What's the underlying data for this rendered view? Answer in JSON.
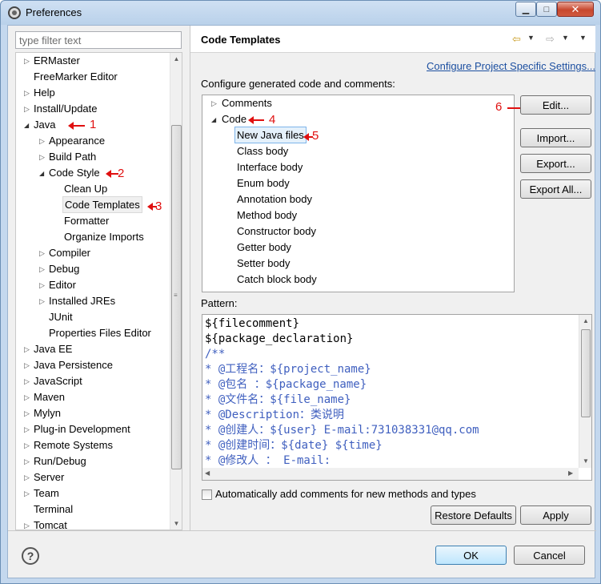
{
  "window": {
    "title": "Preferences"
  },
  "filter": {
    "placeholder": "type filter text"
  },
  "nav_tree": {
    "items": [
      "ERMaster",
      "FreeMarker Editor",
      "Help",
      "Install/Update",
      "Java",
      "Appearance",
      "Build Path",
      "Code Style",
      "Clean Up",
      "Code Templates",
      "Formatter",
      "Organize Imports",
      "Compiler",
      "Debug",
      "Editor",
      "Installed JREs",
      "JUnit",
      "Properties Files Editor",
      "Java EE",
      "Java Persistence",
      "JavaScript",
      "Maven",
      "Mylyn",
      "Plug-in Development",
      "Remote Systems",
      "Run/Debug",
      "Server",
      "Team",
      "Terminal",
      "Tomcat"
    ]
  },
  "annotations": [
    "1",
    "2",
    "3",
    "4",
    "5",
    "6"
  ],
  "page": {
    "title": "Code Templates",
    "config_link": "Configure Project Specific Settings...",
    "description": "Configure generated code and comments:"
  },
  "template_tree": {
    "groups": [
      "Comments",
      "Code"
    ],
    "code_items": [
      "New Java files",
      "Class body",
      "Interface body",
      "Enum body",
      "Annotation body",
      "Method body",
      "Constructor body",
      "Getter body",
      "Setter body",
      "Catch block body"
    ]
  },
  "side_buttons": {
    "edit": "Edit...",
    "import": "Import...",
    "export": "Export...",
    "export_all": "Export All..."
  },
  "pattern": {
    "label": "Pattern:",
    "lines": [
      "${filecomment}",
      "${package_declaration}",
      "/**",
      "* @工程名：${project_name}",
      "* @包名  ：${package_name}",
      "* @文件名：${file_name}",
      "* @Description：类说明",
      "* @创建人：${user}     E-mail:731038331@qq.com",
      "* @创建时间：${date}   ${time}",
      "* @修改人  ：   E-mail:"
    ]
  },
  "auto_comments_label": "Automatically add comments for new methods and types",
  "buttons": {
    "restore": "Restore Defaults",
    "apply": "Apply",
    "ok": "OK",
    "cancel": "Cancel"
  },
  "colors": {
    "annotation": "#e01010",
    "link": "#1c4fa0",
    "comment_code": "#3f5fbf"
  }
}
